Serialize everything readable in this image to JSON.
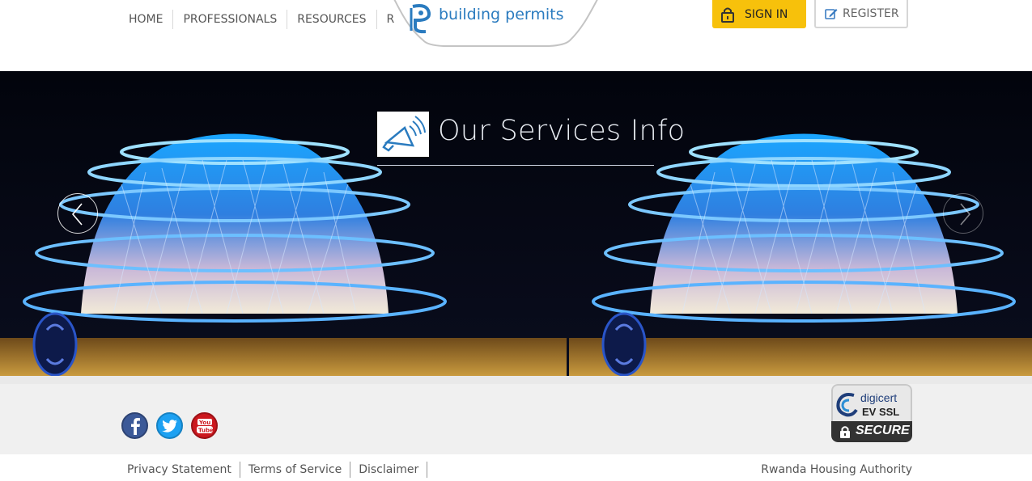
{
  "nav": {
    "items": [
      {
        "label": "HOME"
      },
      {
        "label": "PROFESSIONALS"
      },
      {
        "label": "RESOURCES"
      },
      {
        "label": "REF"
      }
    ]
  },
  "logo": {
    "text": "building permits"
  },
  "account": {
    "sign_in": "SIGN IN",
    "register": "REGISTER"
  },
  "hero": {
    "title": "Our Services Info"
  },
  "footer": {
    "links": [
      {
        "label": "Privacy Statement"
      },
      {
        "label": "Terms of Service"
      },
      {
        "label": "Disclaimer"
      }
    ],
    "organization": "Rwanda Housing Authority",
    "badge": {
      "brand": "digicert",
      "type": "EV SSL",
      "status": "SECURE"
    }
  },
  "social": [
    "facebook",
    "twitter",
    "youtube"
  ],
  "colors": {
    "accent_yellow": "#f7c10b",
    "brand_blue": "#2a7bbf"
  }
}
